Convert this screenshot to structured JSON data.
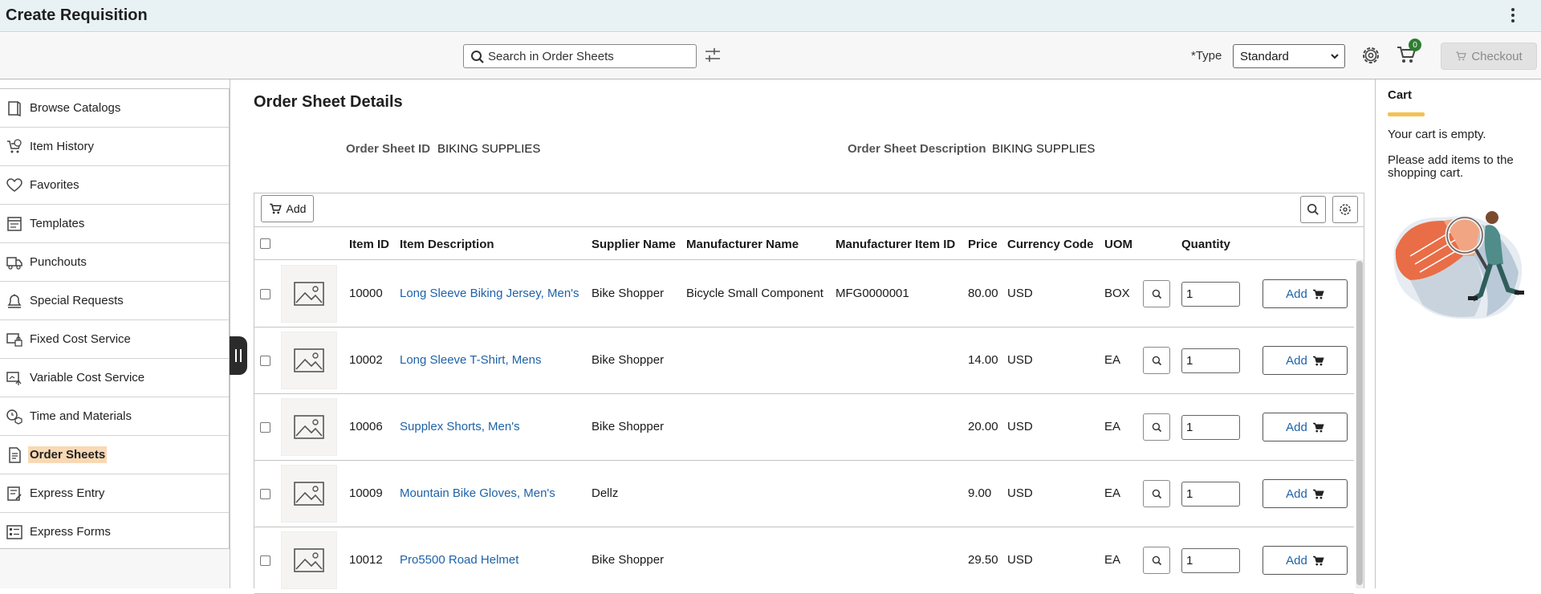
{
  "app": {
    "title": "Create Requisition"
  },
  "toolbar": {
    "search_placeholder": "Search in Order Sheets",
    "type_label": "*Type",
    "type_value": "Standard",
    "cart_count": "0",
    "checkout_label": "Checkout"
  },
  "sidebar": {
    "items": [
      {
        "label": "Browse Catalogs",
        "icon": "book-icon"
      },
      {
        "label": "Item History",
        "icon": "cart-clock-icon"
      },
      {
        "label": "Favorites",
        "icon": "heart-icon"
      },
      {
        "label": "Templates",
        "icon": "template-icon"
      },
      {
        "label": "Punchouts",
        "icon": "truck-icon"
      },
      {
        "label": "Special Requests",
        "icon": "bell-icon"
      },
      {
        "label": "Fixed Cost Service",
        "icon": "fixed-cost-icon"
      },
      {
        "label": "Variable Cost Service",
        "icon": "variable-cost-icon"
      },
      {
        "label": "Time and Materials",
        "icon": "clock-box-icon"
      },
      {
        "label": "Order Sheets",
        "icon": "document-icon",
        "active": true
      },
      {
        "label": "Express Entry",
        "icon": "express-entry-icon"
      },
      {
        "label": "Express Forms",
        "icon": "form-icon"
      }
    ]
  },
  "main": {
    "title": "Order Sheet Details",
    "sheet_id_label": "Order Sheet ID",
    "sheet_id_value": "BIKING SUPPLIES",
    "sheet_desc_label": "Order Sheet Description",
    "sheet_desc_value": "BIKING SUPPLIES",
    "grid_add_label": "Add",
    "columns": [
      "Item ID",
      "Item Description",
      "Supplier Name",
      "Manufacturer Name",
      "Manufacturer Item ID",
      "Price",
      "Currency Code",
      "UOM",
      "Quantity"
    ],
    "rows": [
      {
        "id": "10000",
        "desc": "Long Sleeve Biking Jersey, Men's",
        "supplier": "Bike Shopper",
        "mfr": "Bicycle Small Component",
        "mfr_id": "MFG0000001",
        "price": "80.00",
        "currency": "USD",
        "uom": "BOX",
        "qty": "1",
        "add": "Add"
      },
      {
        "id": "10002",
        "desc": "Long Sleeve T-Shirt, Mens",
        "supplier": "Bike Shopper",
        "mfr": "",
        "mfr_id": "",
        "price": "14.00",
        "currency": "USD",
        "uom": "EA",
        "qty": "1",
        "add": "Add"
      },
      {
        "id": "10006",
        "desc": "Supplex Shorts, Men's",
        "supplier": "Bike Shopper",
        "mfr": "",
        "mfr_id": "",
        "price": "20.00",
        "currency": "USD",
        "uom": "EA",
        "qty": "1",
        "add": "Add"
      },
      {
        "id": "10009",
        "desc": "Mountain Bike Gloves, Men's",
        "supplier": "Dellz",
        "mfr": "",
        "mfr_id": "",
        "price": "9.00",
        "currency": "USD",
        "uom": "EA",
        "qty": "1",
        "add": "Add"
      },
      {
        "id": "10012",
        "desc": "Pro5500 Road Helmet",
        "supplier": "Bike Shopper",
        "mfr": "",
        "mfr_id": "",
        "price": "29.50",
        "currency": "USD",
        "uom": "EA",
        "qty": "1",
        "add": "Add"
      }
    ]
  },
  "cart": {
    "title": "Cart",
    "empty": "Your cart is empty.",
    "hint": "Please add items to the shopping cart."
  },
  "colors": {
    "accent": "#1e62a8",
    "active_nav": "#f8d9b5",
    "badge": "#2e7d32",
    "cart_bar": "#f5c24d"
  }
}
